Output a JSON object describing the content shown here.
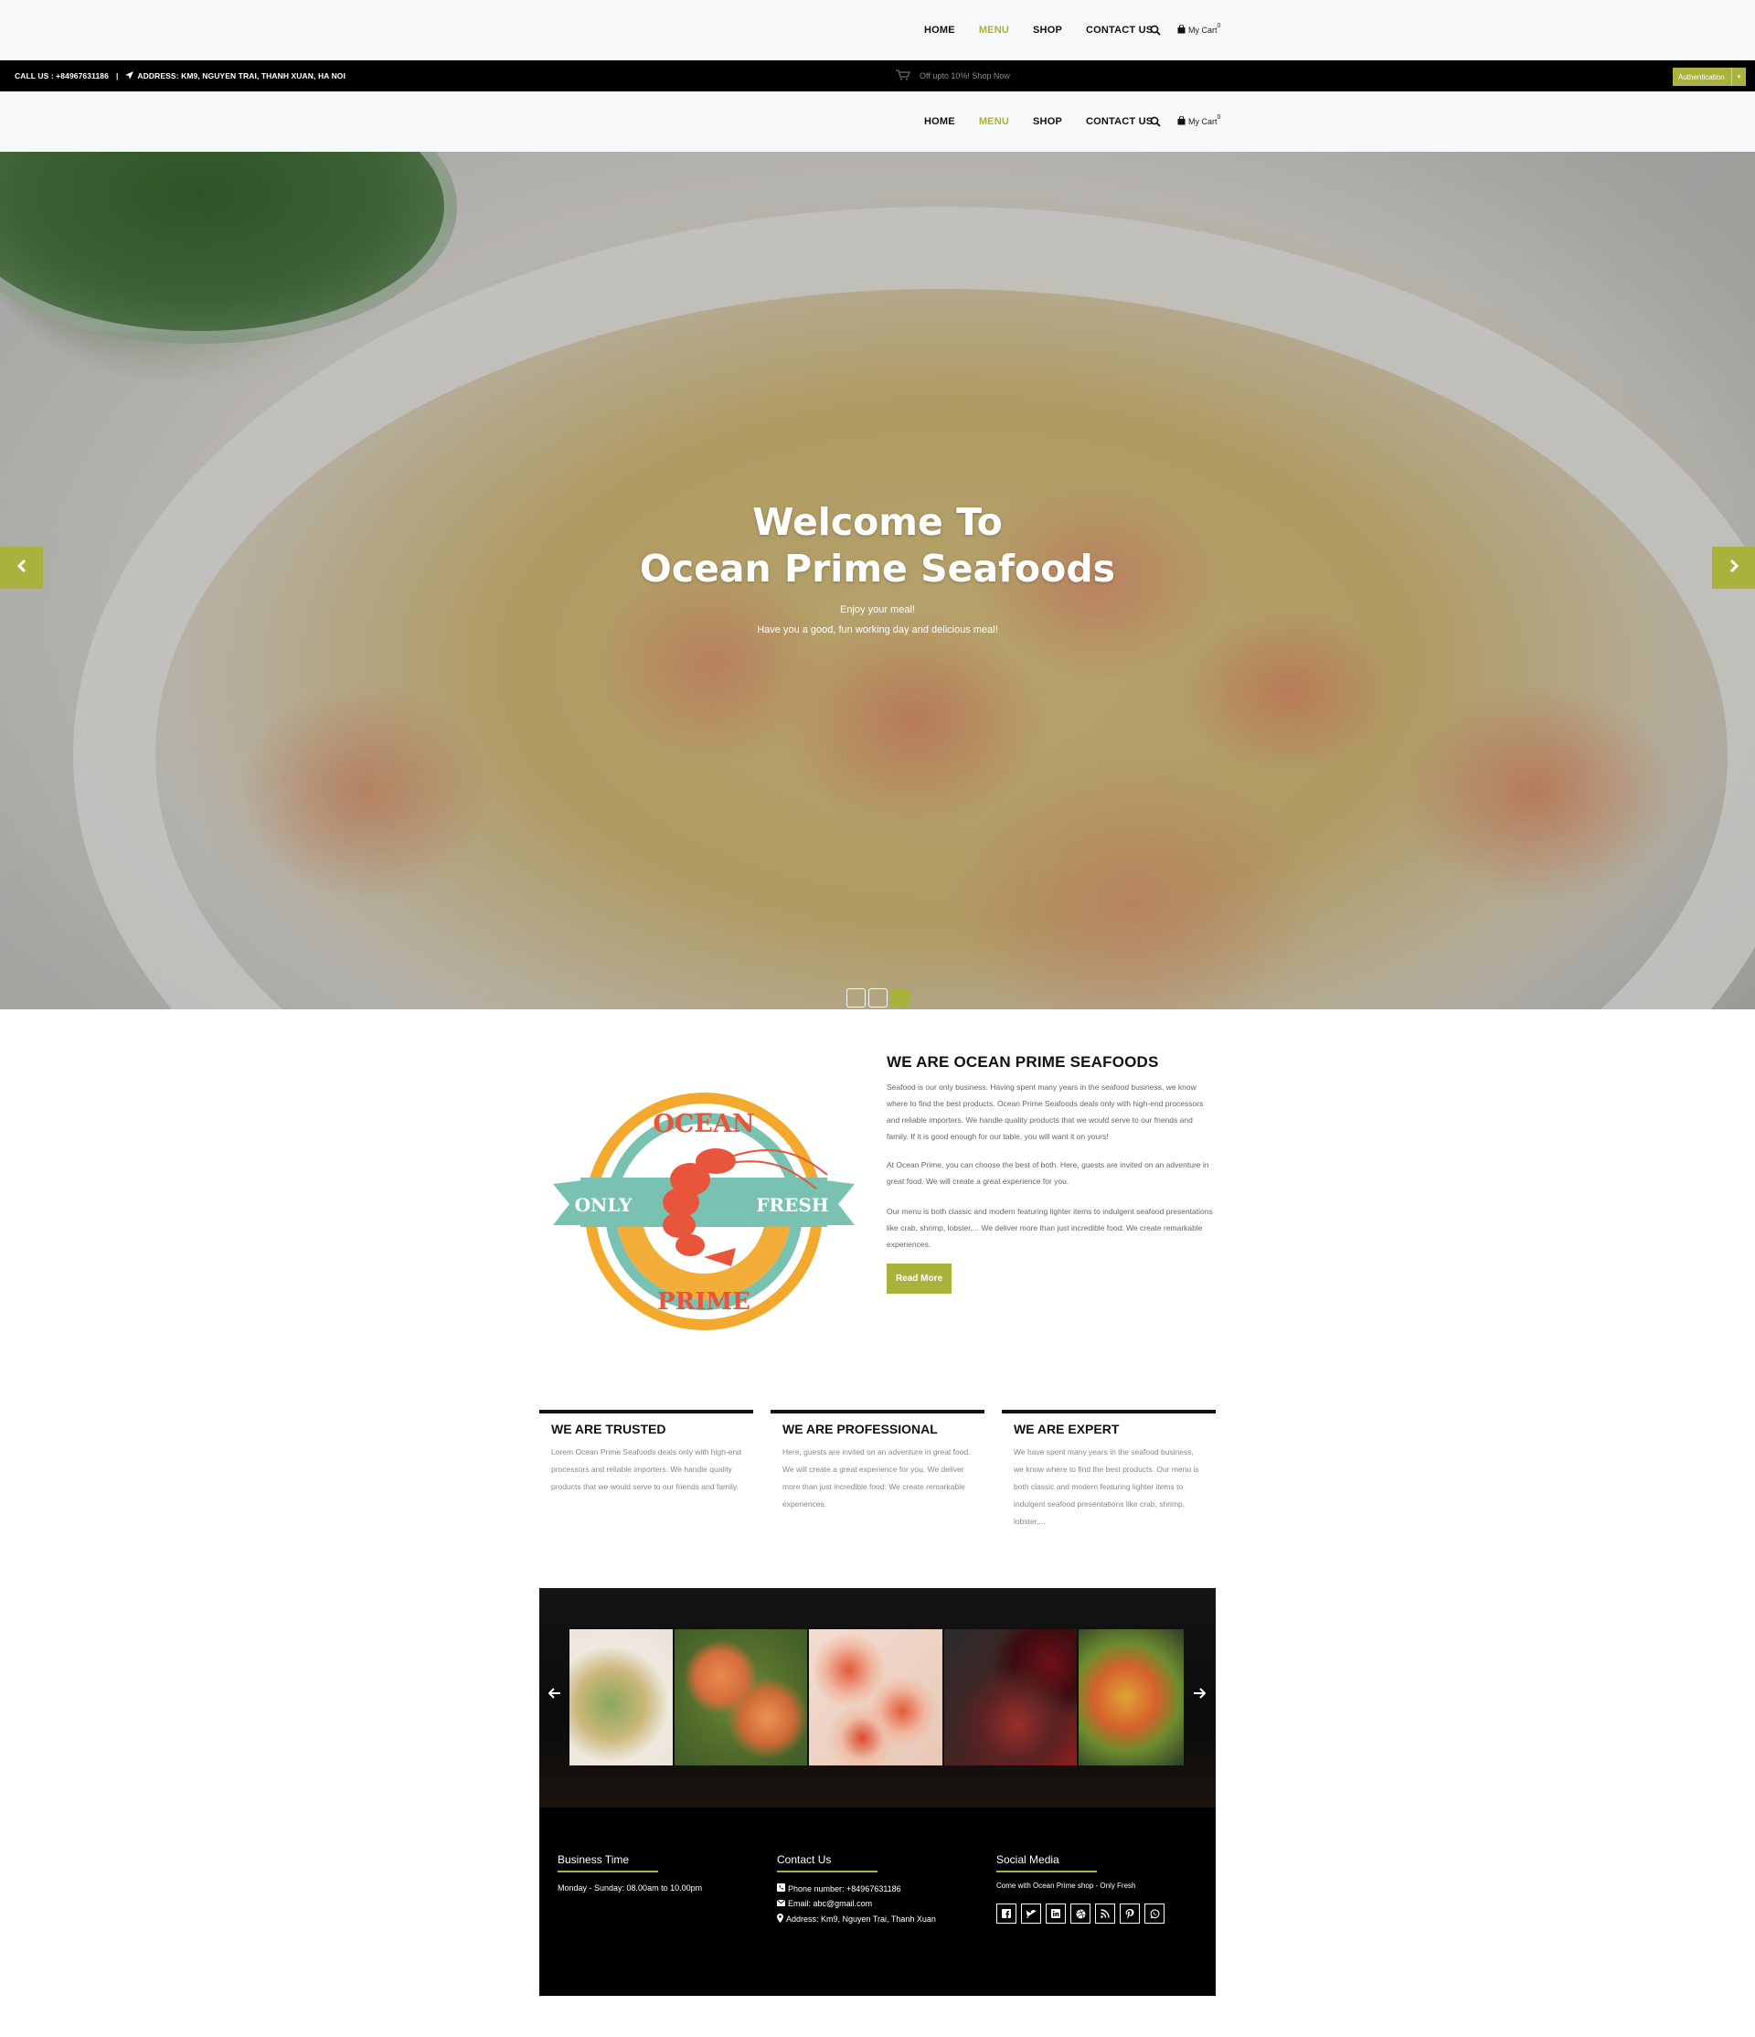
{
  "nav": {
    "links": [
      "HOME",
      "MENU",
      "SHOP",
      "CONTACT US"
    ],
    "active": "MENU",
    "cart_label": "My Cart",
    "cart_count": "0",
    "search_icon": "search-icon",
    "cart_icon": "shopping-bag-icon"
  },
  "infobar": {
    "call": "CALL US : +84967631186",
    "address": "ADDRESS: KM9, NGUYEN TRAI, THANH XUAN, HA NOI",
    "promo": "Off upto 10%! Shop Now",
    "auth_label": "Authentication"
  },
  "hero": {
    "title_line1": "Welcome To",
    "title_line2": "Ocean Prime Seafoods",
    "sub1": "Enjoy your meal!",
    "sub2": "Have you a good, fun working day and delicious meal!",
    "slides": 3,
    "active_slide": 3
  },
  "about": {
    "logo": {
      "top": "OCEAN",
      "left": "ONLY",
      "right": "FRESH",
      "bottom": "PRIME"
    },
    "title": "WE ARE OCEAN PRIME SEAFOODS",
    "p1": "Seafood is our only business. Having spent many years in the seafood business, we know where to find the best products. Ocean Prime Seafoods deals only with high-end processors and reliable importers. We handle quality products that we would serve to our friends and family. If it is good enough for our table, you will want it on yours!",
    "p2": "At Ocean Prime, you can choose the best of both. Here, guests are invited on an adventure in great food. We will create a great experience for you.",
    "p3": "Our menu is both classic and modern featuring lighter items to indulgent seafood presentations like crab, shrimp, lobster,... We deliver more than just incredible food: We create remarkable experiences.",
    "button": "Read More"
  },
  "features": [
    {
      "title": "WE ARE TRUSTED",
      "text": "Lorem Ocean Prime Seafoods deals only with high-end processors and reliable importers. We handle quality products that we would serve to our friends and family."
    },
    {
      "title": "WE ARE PROFESSIONAL",
      "text": "Here, guests are invited on an adventure in great food. We will create a great experience for you. We deliver more than just incredible food: We create remarkable experiences."
    },
    {
      "title": "WE ARE EXPERT",
      "text": "We have spent many years in the seafood business, we know where to find the best products. Our menu is both classic and modern featuring lighter items to indulgent seafood presentations like crab, shrimp, lobster,..."
    }
  ],
  "footer": {
    "business": {
      "heading": "Business Time",
      "hours": "Monday - Sunday: 08.00am to 10.00pm"
    },
    "contact": {
      "heading": "Contact Us",
      "phone": "Phone number: +84967631186",
      "email": "Email: abc@gmail.com",
      "address": "Address: Km9, Nguyen Trai, Thanh Xuan"
    },
    "social": {
      "heading": "Social Media",
      "tagline": "Come with Ocean Prime shop - Only Fresh",
      "icons": [
        "facebook-icon",
        "twitter-icon",
        "linkedin-icon",
        "dribbble-icon",
        "rss-icon",
        "pinterest-icon",
        "whatsapp-icon"
      ]
    }
  },
  "colors": {
    "accent": "#a9b23a",
    "topbar": "#000000",
    "nav_bg": "#f7f8fa"
  }
}
